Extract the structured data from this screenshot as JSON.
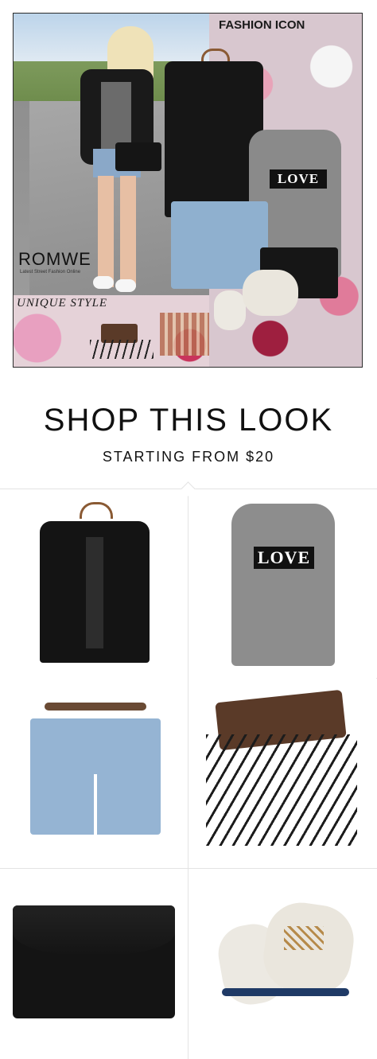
{
  "collage": {
    "logo": "ROMWE",
    "tagline": "Latest Street Fashion Online",
    "title_top": "FASHION ICON",
    "title_bottom": "UNIQUE STYLE",
    "tee_text": "LOVE"
  },
  "shop": {
    "title": "SHOP THIS LOOK",
    "subtitle": "STARTING FROM $20"
  },
  "products": [
    {
      "name": "black-jacket",
      "text": ""
    },
    {
      "name": "love-tee",
      "text": "LOVE"
    },
    {
      "name": "denim-shorts",
      "text": ""
    },
    {
      "name": "brush-set",
      "text": ""
    },
    {
      "name": "black-clutch",
      "text": ""
    },
    {
      "name": "sneakers",
      "text": ""
    }
  ]
}
